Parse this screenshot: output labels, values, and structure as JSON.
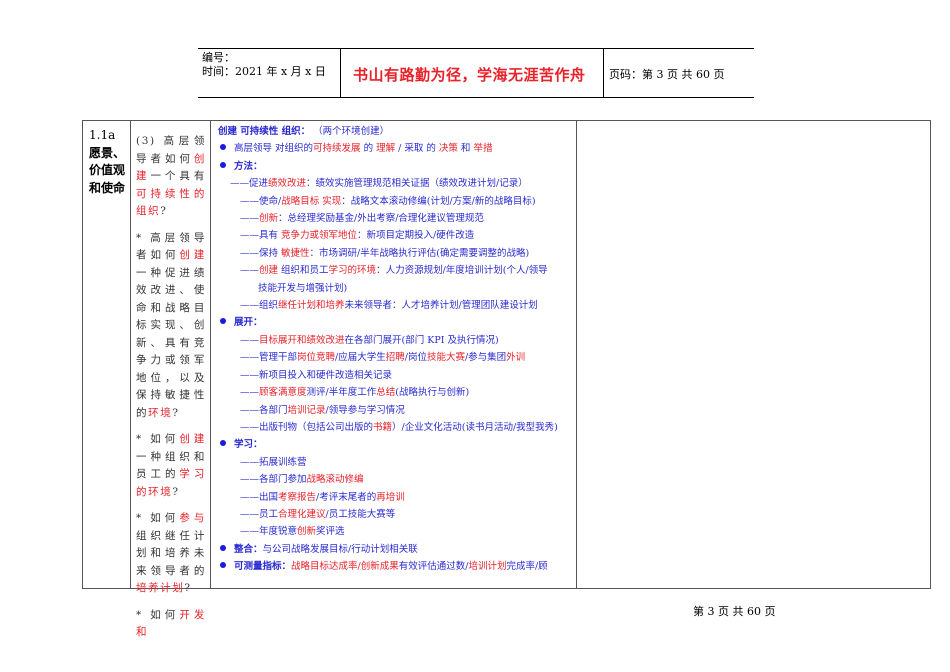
{
  "header": {
    "number_label": "编号：",
    "time_label": "时间：2021 年 x 月 x 日",
    "motto": "书山有路勤为径，学海无涯苦作舟",
    "page_label": "页码：第 3 页  共 60 页"
  },
  "row": {
    "section_number": "1.1a",
    "section_title": "愿景、价值观和使命",
    "questions": [
      [
        [
          "(3) 高层领导者如何",
          "k"
        ],
        [
          "创建",
          "r"
        ],
        [
          "一个具有",
          "k"
        ],
        [
          "可持续性的组织",
          "r"
        ],
        [
          "?",
          "k"
        ]
      ],
      [
        [
          "* 高层领导者如何",
          "k"
        ],
        [
          "创建",
          "r"
        ],
        [
          "一种促进绩效改进、使命和战略目标实现、创新、具有竞争力或领军地位，以及保持敏捷性的",
          "k"
        ],
        [
          "环境",
          "r"
        ],
        [
          "?",
          "k"
        ]
      ],
      [
        [
          "* 如何",
          "k"
        ],
        [
          "创建",
          "r"
        ],
        [
          "一种组织和员工的",
          "k"
        ],
        [
          "学习的环境",
          "r"
        ],
        [
          "?",
          "k"
        ]
      ],
      [
        [
          "* 如何",
          "k"
        ],
        [
          "参与",
          "r"
        ],
        [
          "组织继任计划和培养未来领导者的",
          "k"
        ],
        [
          "培养计划",
          "r"
        ],
        [
          "?",
          "k"
        ]
      ],
      [
        [
          "* 如何",
          "k"
        ],
        [
          "开发和",
          "r"
        ]
      ]
    ],
    "content": [
      {
        "type": "title",
        "segs": [
          [
            "创建  可持续性  组织：",
            "b bold"
          ],
          [
            "      （两个环境创建）",
            "b"
          ]
        ]
      },
      {
        "type": "bullet",
        "segs": [
          [
            "高层领导  对组织的",
            "b"
          ],
          [
            "可持续发展",
            "r"
          ],
          [
            "  的  ",
            "b"
          ],
          [
            "理解",
            "r"
          ],
          [
            "  / 采取  的  ",
            "b"
          ],
          [
            "决策",
            "r"
          ],
          [
            "  和  ",
            "b"
          ],
          [
            "举措",
            "r"
          ]
        ]
      },
      {
        "type": "bullet",
        "segs": [
          [
            "方法：",
            "b bold"
          ]
        ]
      },
      {
        "type": "dash",
        "segs": [
          [
            "——促进",
            "b"
          ],
          [
            "绩效改进",
            "r"
          ],
          [
            "：绩效实施管理规范相关证据（绩效改进计划/记录）",
            "b"
          ]
        ]
      },
      {
        "type": "dash2",
        "segs": [
          [
            "——使命/",
            "b"
          ],
          [
            "战略目标  实现",
            "r"
          ],
          [
            "：战略文本滚动修编(计划/方案/新的战略目标)",
            "b"
          ]
        ]
      },
      {
        "type": "dash2",
        "segs": [
          [
            "——",
            "b"
          ],
          [
            "创新",
            "r"
          ],
          [
            "：总经理奖励基金/外出考察/合理化建议管理规范",
            "b"
          ]
        ]
      },
      {
        "type": "dash2",
        "segs": [
          [
            "——具有  ",
            "b"
          ],
          [
            "竞争力或领军地位",
            "r"
          ],
          [
            "：新项目定期投入/硬件改造",
            "b"
          ]
        ]
      },
      {
        "type": "dash2",
        "segs": [
          [
            "——保持  ",
            "b"
          ],
          [
            "敏捷性",
            "r"
          ],
          [
            "：市场调研/半年战略执行评估(确定需要调整的战略)",
            "b"
          ]
        ]
      },
      {
        "type": "dash2",
        "segs": [
          [
            "——",
            "b"
          ],
          [
            "创建",
            "r"
          ],
          [
            "  组织和员工",
            "b"
          ],
          [
            "学习的环境",
            "r"
          ],
          [
            "：人力资源规划/年度培训计划(个人/领导",
            "b"
          ]
        ]
      },
      {
        "type": "cont",
        "segs": [
          [
            "技能开发与增强计划)",
            "b"
          ]
        ]
      },
      {
        "type": "dash2",
        "segs": [
          [
            "——组织",
            "b"
          ],
          [
            "继任计划和培养",
            "r"
          ],
          [
            "未来领导者：人才培养计划/管理团队建设计划",
            "b"
          ]
        ]
      },
      {
        "type": "bullet",
        "segs": [
          [
            "展开：",
            "b bold"
          ]
        ]
      },
      {
        "type": "dash2",
        "segs": [
          [
            "——",
            "b"
          ],
          [
            "目标展开和绩效改进",
            "r"
          ],
          [
            "在各部门展开(部门 KPI 及执行情况)",
            "b"
          ]
        ]
      },
      {
        "type": "dash2",
        "segs": [
          [
            "——管理干部",
            "b"
          ],
          [
            "岗位竞聘",
            "r"
          ],
          [
            "/应届大学生",
            "b"
          ],
          [
            "招聘",
            "r"
          ],
          [
            "/岗位",
            "b"
          ],
          [
            "技能大赛",
            "r"
          ],
          [
            "/参与集团",
            "b"
          ],
          [
            "外训",
            "r"
          ]
        ]
      },
      {
        "type": "dash2",
        "segs": [
          [
            "——新项目投入和硬件改造相关记录",
            "b"
          ]
        ]
      },
      {
        "type": "dash2",
        "segs": [
          [
            "——",
            "b"
          ],
          [
            "顾客满意度",
            "r"
          ],
          [
            "测评/半年度工作",
            "b"
          ],
          [
            "总结",
            "r"
          ],
          [
            "(战略执行与创新)",
            "b"
          ]
        ]
      },
      {
        "type": "dash2",
        "segs": [
          [
            "——各部门",
            "b"
          ],
          [
            "培训记录",
            "r"
          ],
          [
            "/领导参与学习情况",
            "b"
          ]
        ]
      },
      {
        "type": "dash2",
        "segs": [
          [
            "——出版刊物（包括公司出版的",
            "b"
          ],
          [
            "书籍",
            "r"
          ],
          [
            "）/企业文化活动(读书月活动/我型我秀)",
            "b"
          ]
        ]
      },
      {
        "type": "bullet",
        "segs": [
          [
            "学习：",
            "b bold"
          ]
        ]
      },
      {
        "type": "dash2",
        "segs": [
          [
            "——拓展训练营",
            "b"
          ]
        ]
      },
      {
        "type": "dash2",
        "segs": [
          [
            "——各部门参加",
            "b"
          ],
          [
            "战略滚动修编",
            "r"
          ]
        ]
      },
      {
        "type": "dash2",
        "segs": [
          [
            "——出国",
            "b"
          ],
          [
            "考察报告",
            "r"
          ],
          [
            "/考评末尾者的",
            "b"
          ],
          [
            "再培训",
            "r"
          ]
        ]
      },
      {
        "type": "dash2",
        "segs": [
          [
            "——员工",
            "b"
          ],
          [
            "合理化建议",
            "r"
          ],
          [
            "/员工技能大赛等",
            "b"
          ]
        ]
      },
      {
        "type": "dash2",
        "segs": [
          [
            "——年度锐意",
            "b"
          ],
          [
            "创新",
            "r"
          ],
          [
            "奖评选",
            "b"
          ]
        ]
      },
      {
        "type": "bullet",
        "segs": [
          [
            "整合：",
            "b bold"
          ],
          [
            "与公司战略发展目标/行动计划相关联",
            "b"
          ]
        ]
      },
      {
        "type": "bullet",
        "segs": [
          [
            "可测量指标：",
            "b bold"
          ],
          [
            "战略目标达成率/",
            "r"
          ],
          [
            "创新成果",
            "r"
          ],
          [
            "有效评估通过数/",
            "b"
          ],
          [
            "培训计划",
            "r"
          ],
          [
            "完成率/顾",
            "b"
          ]
        ]
      }
    ]
  },
  "footer": {
    "page_text": "第 3 页 共 60 页"
  }
}
